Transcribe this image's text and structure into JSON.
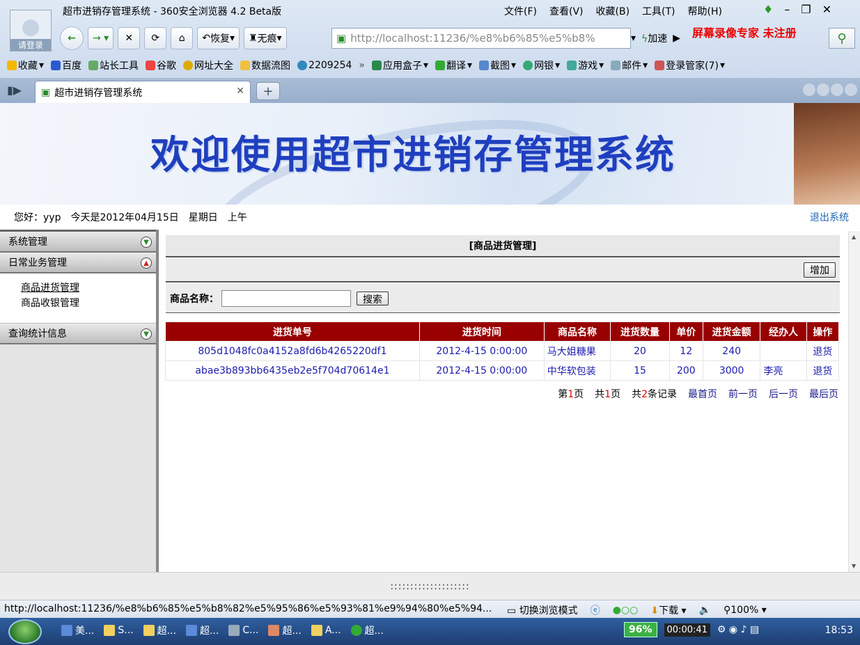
{
  "browser": {
    "window_title": "超市进销存管理系统 - 360安全浏览器 4.2 Beta版",
    "avatar_label": "请登录",
    "menu": [
      "文件(F)",
      "查看(V)",
      "收藏(B)",
      "工具(T)",
      "帮助(H)"
    ],
    "nav": {
      "restore_label": "恢复",
      "incognito_label": "无痕"
    },
    "url": "http://localhost:11236/%e8%b6%85%e5%b8%",
    "speed_label": "加速",
    "recorder_watermark": "屏幕录像专家  未注册",
    "favorites": [
      "收藏",
      "百度",
      "站长工具",
      "谷歌",
      "网址大全",
      "数据流图",
      "2209254",
      "»",
      "应用盒子",
      "翻译",
      "截图",
      "网银",
      "游戏",
      "邮件",
      "登录管家(7)"
    ],
    "tab_title": "超市进销存管理系统",
    "status_url": "http://localhost:11236/%e8%b6%85%e5%b8%82%e5%95%86%e5%93%81%e9%94%80%e5%94...",
    "status_mode": "切换浏览模式",
    "status_download": "下载",
    "status_zoom": "100%"
  },
  "page": {
    "banner_title": "欢迎使用超市进销存管理系统",
    "greeting": "您好：yyp",
    "date_text": "今天是2012年04月15日",
    "weekday": "星期日",
    "ampm": "上午",
    "logout_label": "退出系统",
    "sidebar": {
      "sections": [
        {
          "label": "系统管理",
          "state": "collapsed"
        },
        {
          "label": "日常业务管理",
          "state": "expanded"
        },
        {
          "label": "查询统计信息",
          "state": "collapsed"
        }
      ],
      "sub_items": [
        "商品进货管理",
        "商品收银管理"
      ]
    },
    "panel_title": "[商品进货管理]",
    "add_label": "增加",
    "search_label": "商品名称：",
    "search_value": "",
    "search_button": "搜索",
    "table": {
      "headers": [
        "进货单号",
        "进货时间",
        "商品名称",
        "进货数量",
        "单价",
        "进货金额",
        "经办人",
        "操作"
      ],
      "rows": [
        [
          "805d1048fc0a4152a8fd6b4265220df1",
          "2012-4-15 0:00:00",
          "马大姐糖果",
          "20",
          "12",
          "240",
          "",
          "退货"
        ],
        [
          "abae3b893bb6435eb2e5f704d70614e1",
          "2012-4-15 0:00:00",
          "中华软包装",
          "15",
          "200",
          "3000",
          "李亮",
          "退货"
        ]
      ]
    },
    "pager": {
      "page_prefix": "第",
      "page_num": "1",
      "page_suffix": "页",
      "total_prefix": "共",
      "total_pages": "1",
      "total_suffix": "页",
      "records_prefix": "共",
      "records_num": "2",
      "records_suffix": "条记录",
      "first": "最首页",
      "prev": "前一页",
      "next": "后一页",
      "last": "最后页"
    },
    "footer_dots": "::::::::::::::::::::"
  },
  "taskbar": {
    "items": [
      "美...",
      "S...",
      "超...",
      "超...",
      "C...",
      "超...",
      "A...",
      "超..."
    ],
    "percent": "96%",
    "timer": "00:00:41",
    "clock": "18:53"
  }
}
